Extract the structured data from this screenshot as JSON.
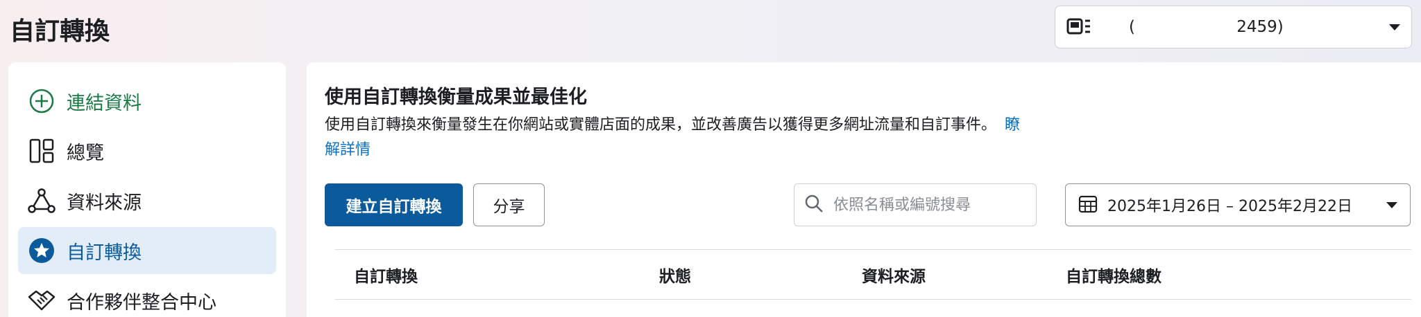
{
  "header": {
    "title": "自訂轉換",
    "account_selector": {
      "text": "(                    2459)"
    }
  },
  "sidebar": {
    "items": [
      {
        "label": "連結資料",
        "icon": "plus-circle-icon"
      },
      {
        "label": "總覽",
        "icon": "dashboard-layout-icon"
      },
      {
        "label": "資料來源",
        "icon": "data-sources-icon"
      },
      {
        "label": "自訂轉換",
        "icon": "star-badge-icon"
      },
      {
        "label": "合作夥伴整合中心",
        "icon": "handshake-icon"
      }
    ],
    "active_index": 3
  },
  "main": {
    "heading": "使用自訂轉換衡量成果並最佳化",
    "description": "使用自訂轉換來衡量發生在你網站或實體店面的成果，並改善廣告以獲得更多網址流量和自訂事件。",
    "learn_more": "瞭解詳情",
    "create_button": "建立自訂轉換",
    "share_button": "分享",
    "search_placeholder": "依照名稱或編號搜尋",
    "date_range": "2025年1月26日 – 2025年2月22日"
  },
  "table": {
    "columns": [
      "自訂轉換",
      "狀態",
      "資料來源",
      "自訂轉換總數"
    ]
  },
  "colors": {
    "primary": "#0a5a9c",
    "link": "#0b6fc0",
    "green": "#1b7a43",
    "active_bg": "#e3edf7"
  }
}
